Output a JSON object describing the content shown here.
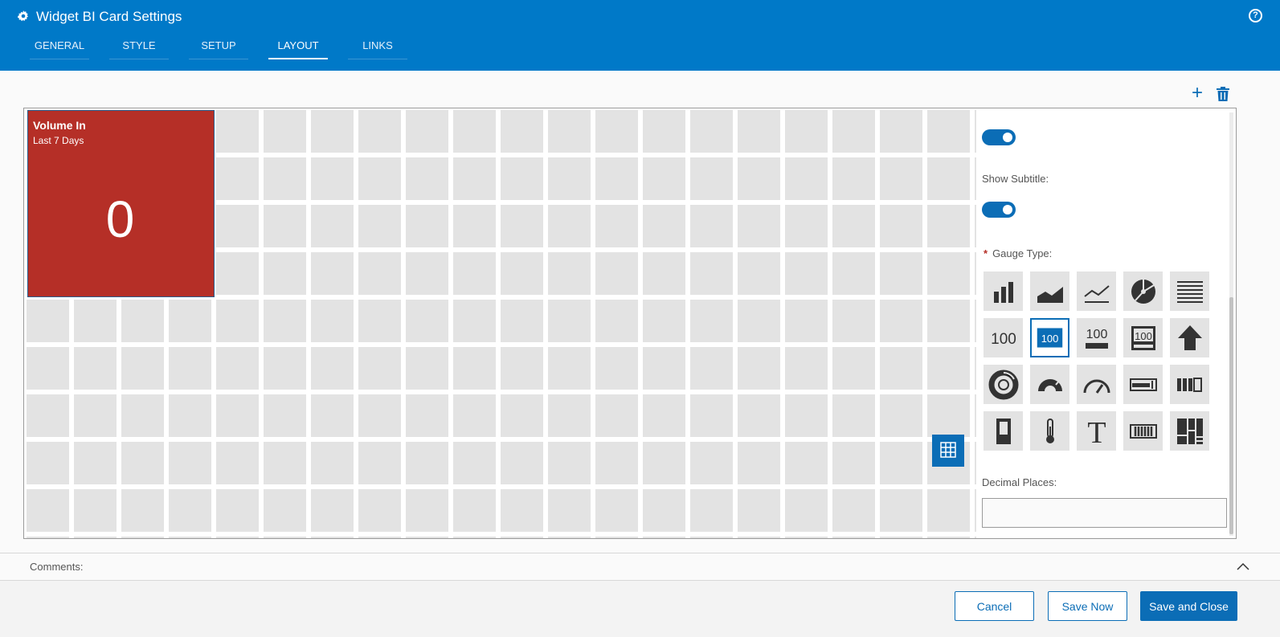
{
  "window": {
    "title": "Widget BI Card Settings",
    "icon": "gear-icon",
    "help_icon": "help-icon"
  },
  "tabs": [
    {
      "label": "GENERAL",
      "active": false
    },
    {
      "label": "STYLE",
      "active": false
    },
    {
      "label": "SETUP",
      "active": false
    },
    {
      "label": "LAYOUT",
      "active": true
    },
    {
      "label": "LINKS",
      "active": false
    }
  ],
  "toolbar": {
    "add_icon": "plus-icon",
    "delete_icon": "trash-icon"
  },
  "card": {
    "title": "Volume In",
    "subtitle": "Last 7 Days",
    "value": "0",
    "color": "#b52f27"
  },
  "settings": {
    "show_title_toggle": true,
    "show_subtitle_label": "Show Subtitle:",
    "show_subtitle_toggle": true,
    "gauge_type_required": "*",
    "gauge_type_label": "Gauge Type:",
    "gauge_types": [
      {
        "icon": "bar-chart-icon"
      },
      {
        "icon": "area-chart-icon"
      },
      {
        "icon": "line-chart-icon"
      },
      {
        "icon": "pie-chart-icon"
      },
      {
        "icon": "list-icon"
      },
      {
        "icon": "number-plain-icon",
        "text": "100"
      },
      {
        "icon": "number-filled-icon",
        "text": "100",
        "selected": true
      },
      {
        "icon": "number-underline-icon",
        "text": "100"
      },
      {
        "icon": "number-framed-icon",
        "text": "100"
      },
      {
        "icon": "arrow-up-icon"
      },
      {
        "icon": "donut-icon"
      },
      {
        "icon": "semi-gauge-icon"
      },
      {
        "icon": "speedometer-icon"
      },
      {
        "icon": "progress-bar-icon"
      },
      {
        "icon": "segmented-bar-icon"
      },
      {
        "icon": "battery-icon"
      },
      {
        "icon": "thermometer-icon"
      },
      {
        "icon": "text-icon",
        "text": "T"
      },
      {
        "icon": "barcode-bar-icon"
      },
      {
        "icon": "treemap-icon"
      }
    ],
    "decimal_places_label": "Decimal Places:",
    "decimal_places_value": ""
  },
  "comments": {
    "label": "Comments:",
    "icon": "chevron-up-icon"
  },
  "footer": {
    "cancel": "Cancel",
    "save_now": "Save Now",
    "save_close": "Save and Close"
  },
  "colors": {
    "header": "#0079c8",
    "accent": "#0b6db6",
    "card": "#b52f27"
  }
}
